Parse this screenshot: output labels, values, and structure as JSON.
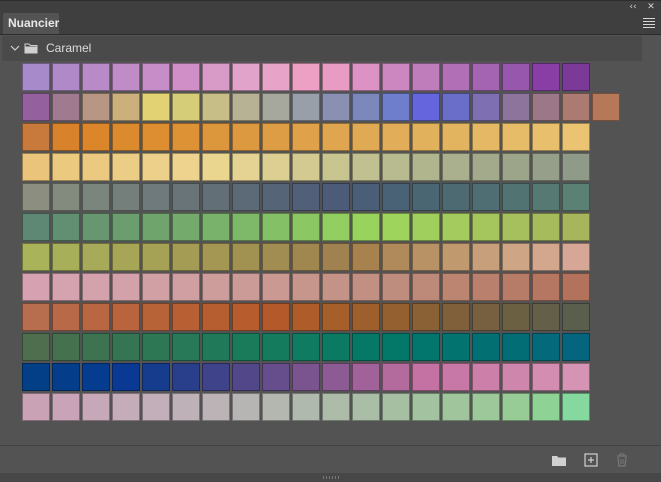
{
  "panel": {
    "tab_label": "Nuancier",
    "collapse_icon": "double-chevron-left-icon",
    "close_icon": "close-icon",
    "menu_icon": "hamburger-menu-icon"
  },
  "group": {
    "name": "Caramel",
    "expanded": true,
    "chevron_icon": "chevron-down-icon",
    "folder_icon": "folder-icon"
  },
  "swatch_rows": [
    [
      "#a78ac9",
      "#b08ac8",
      "#b88bc8",
      "#c08cc7",
      "#c68dc8",
      "#d18fc7",
      "#d89bc8",
      "#e2a3ca",
      "#e8a4c8",
      "#ee9fc4",
      "#e89cc4",
      "#dc92c4",
      "#cc87c0",
      "#bf7dbb",
      "#b16fb6",
      "#a464b2",
      "#9757ad",
      "#883ea4",
      "#7b3a98"
    ],
    [
      "#94609e",
      "#a07a8f",
      "#b79684",
      "#cbb07b",
      "#e2d274",
      "#d6cd79",
      "#c6be86",
      "#b7b293",
      "#a7a89d",
      "#999fa8",
      "#8a90b2",
      "#7c87bc",
      "#6e7ecd",
      "#6566dd",
      "#6a6ec9",
      "#7d6fb1",
      "#8c749d",
      "#9b7787",
      "#ab7a70",
      "#b5795a"
    ],
    [
      "#c87a3d",
      "#d8822c",
      "#db862a",
      "#db8a2e",
      "#dc8e31",
      "#dd9236",
      "#dc963b",
      "#dc993f",
      "#dd9d44",
      "#dfa24a",
      "#e0a54f",
      "#e0a954",
      "#e1ad58",
      "#e2b15c",
      "#e3b460",
      "#e4b865",
      "#e6bc69",
      "#e8c06d",
      "#eac473"
    ],
    [
      "#e9c47a",
      "#ebc97e",
      "#ecc981",
      "#eccd85",
      "#edd089",
      "#edd38d",
      "#ebd690",
      "#e4d392",
      "#dccf91",
      "#d2ca91",
      "#c9c590",
      "#c0c090",
      "#b8bb8f",
      "#b1b58d",
      "#aab08d",
      "#a3aa8b",
      "#9ca48a",
      "#969f89",
      "#8f9a88"
    ],
    [
      "#8c8f7f",
      "#838b7f",
      "#7a857e",
      "#747f7c",
      "#6e7a7b",
      "#687478",
      "#626f77",
      "#5c6977",
      "#566477",
      "#516078",
      "#4b5b78",
      "#4a5e78",
      "#4a6275",
      "#4b6673",
      "#4d6a72",
      "#4e6e73",
      "#517372",
      "#567a73",
      "#5b8074"
    ],
    [
      "#5e8873",
      "#628f72",
      "#679670",
      "#6b9d6f",
      "#6fa46d",
      "#74ab6c",
      "#79b26a",
      "#7eb969",
      "#84c066",
      "#8bc763",
      "#92ce60",
      "#98d45d",
      "#9ed45c",
      "#a1cf5d",
      "#a3cb5d",
      "#a4c65d",
      "#a5c05d",
      "#a6bb5c",
      "#a7b65c"
    ],
    [
      "#a8b35a",
      "#a8af59",
      "#a7aa58",
      "#a6a656",
      "#a5a155",
      "#a49c54",
      "#a39753",
      "#a29252",
      "#a18c51",
      "#a08750",
      "#9f824f",
      "#a7824f",
      "#b08a5a",
      "#b89165",
      "#c0996f",
      "#c79f7a",
      "#cfa685",
      "#d3a78d",
      "#d6a797"
    ],
    [
      "#d6a1b0",
      "#d5a2b0",
      "#d4a2ad",
      "#d3a1a9",
      "#d1a0a5",
      "#cf9fa1",
      "#cd9d9c",
      "#cb9b97",
      "#c99992",
      "#c6968d",
      "#c49388",
      "#c29083",
      "#bf8d7d",
      "#bd8978",
      "#bb8572",
      "#b9816d",
      "#b77c67",
      "#b57761",
      "#b3725b"
    ],
    [
      "#b66e4f",
      "#b86a48",
      "#b86742",
      "#b9643d",
      "#b86238",
      "#b86034",
      "#b75e30",
      "#b65c2d",
      "#b45a2a",
      "#ae5c29",
      "#a65e2a",
      "#9d5f2b",
      "#946030",
      "#8a6035",
      "#80603a",
      "#76603f",
      "#6c6043",
      "#635f48",
      "#5a5e4c"
    ],
    [
      "#4f6e4d",
      "#46714f",
      "#3d7351",
      "#357553",
      "#2e7755",
      "#277957",
      "#207a59",
      "#1a7b5b",
      "#147b5d",
      "#0f7b60",
      "#0a7a63",
      "#067966",
      "#037869",
      "#02766c",
      "#02736f",
      "#027072",
      "#036d76",
      "#04697a",
      "#05657e"
    ],
    [
      "#023f86",
      "#043e8b",
      "#063c8f",
      "#093993",
      "#163c8d",
      "#2a3f8b",
      "#3e438a",
      "#524889",
      "#664e8c",
      "#7a548f",
      "#8d5b93",
      "#a06298",
      "#b36a9d",
      "#c472a3",
      "#c878a6",
      "#cc7fa9",
      "#cf86ad",
      "#d28db0",
      "#d594b4"
    ],
    [
      "#c9a2b6",
      "#c9a4b8",
      "#c7a8b9",
      "#c5acb9",
      "#c2afb9",
      "#bfb1b8",
      "#bbb3b6",
      "#b7b5b3",
      "#b4b7b0",
      "#b0b9ad",
      "#adbba9",
      "#aabda6",
      "#a6bfa3",
      "#a3c2a0",
      "#a0c59d",
      "#9dc89a",
      "#98cc97",
      "#8fd296",
      "#85d89e"
    ]
  ],
  "footer": {
    "new_group_icon": "folder-icon",
    "new_swatch_icon": "add-square-icon",
    "delete_icon": "trash-icon"
  }
}
